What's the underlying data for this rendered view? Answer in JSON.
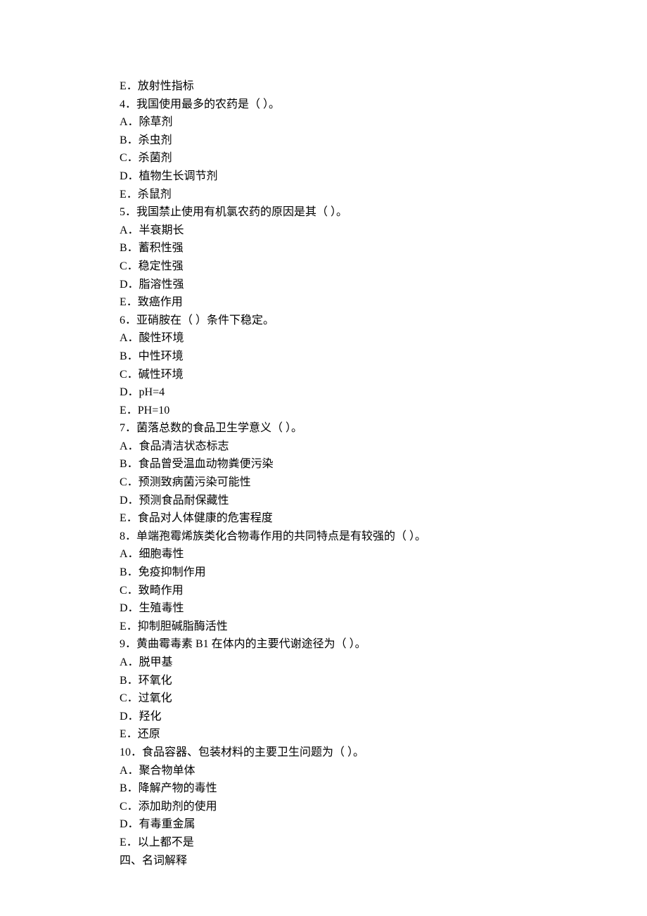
{
  "lines": [
    "E．放射性指标",
    "4．我国使用最多的农药是（ ）。",
    "A．除草剂",
    "B．杀虫剂",
    "C．杀菌剂",
    "D．植物生长调节剂",
    "E．杀鼠剂",
    "5．我国禁止使用有机氯农药的原因是其（ ）。",
    "A．半衰期长",
    "B．蓄积性强",
    "C．稳定性强",
    "D．脂溶性强",
    "E．致癌作用",
    "6．亚硝胺在（ ）条件下稳定。",
    "A．酸性环境",
    "B．中性环境",
    "C．碱性环境",
    "D．pH=4",
    "E．PH=10",
    "7．菌落总数的食品卫生学意义（ ）。",
    "A．食品清洁状态标志",
    "B．食品曾受温血动物粪便污染",
    "C．预测致病菌污染可能性",
    "D．预测食品耐保藏性",
    "E．食品对人体健康的危害程度",
    "8．单端孢霉烯族类化合物毒作用的共同特点是有较强的（ ）。",
    "A．细胞毒性",
    "B．免疫抑制作用",
    "C．致畸作用",
    "D．生殖毒性",
    "E．抑制胆碱脂酶活性",
    "9．黄曲霉毒素 B1 在体内的主要代谢途径为（ ）。",
    "A．脱甲基",
    "B．环氧化",
    "C．过氧化",
    "D．羟化",
    "E．还原",
    "10．食品容器、包装材料的主要卫生问题为（ ）。",
    "A．聚合物单体",
    "B．降解产物的毒性",
    "C．添加助剂的使用",
    "D．有毒重金属",
    "E．以上都不是",
    "四、名词解释"
  ]
}
